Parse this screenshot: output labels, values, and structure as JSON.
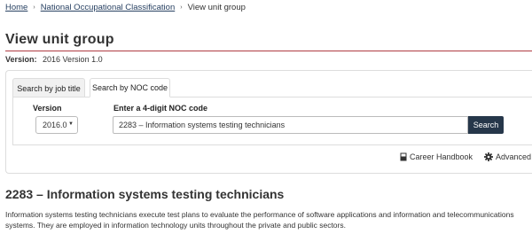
{
  "breadcrumb": {
    "items": [
      {
        "label": "Home"
      },
      {
        "label": "National Occupational Classification"
      }
    ],
    "current": "View unit group",
    "separator": "›"
  },
  "page": {
    "title": "View unit group",
    "version_label": "Version:",
    "version_value": "2016 Version 1.0"
  },
  "tabs": [
    {
      "label": "Search by job title",
      "active": false
    },
    {
      "label": "Search by NOC code",
      "active": true
    }
  ],
  "form": {
    "version_label": "Version",
    "version_selected": "2016.0",
    "noc_label": "Enter a 4-digit NOC code",
    "noc_value": "2283 – Information systems testing technicians",
    "search_label": "Search"
  },
  "links": {
    "career_handbook": "Career Handbook",
    "advanced": "Advanced"
  },
  "result": {
    "title": "2283 – Information systems testing technicians",
    "description": "Information systems testing technicians execute test plans to evaluate the performance of software applications and information and telecommunications systems. They are employed in information technology units throughout the private and public sectors."
  },
  "colors": {
    "link": "#284162",
    "title_rule": "#af3c43",
    "search_button": "#26374a"
  },
  "icons": [
    "book-icon",
    "gear-icon",
    "chevron-down-icon"
  ]
}
